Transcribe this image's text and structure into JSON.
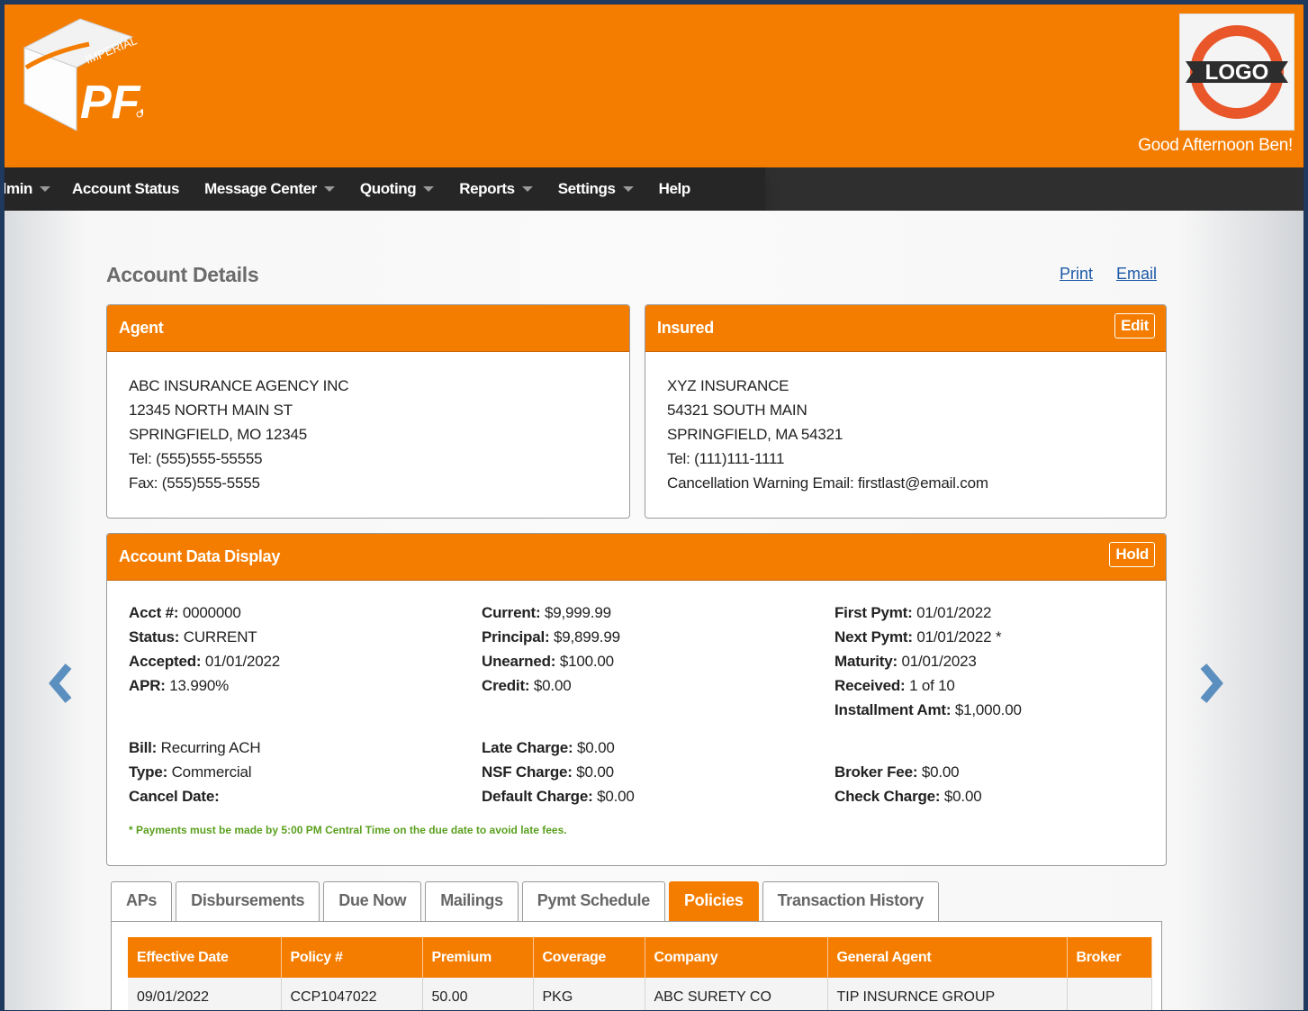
{
  "brand": {
    "logo_text_top": "IMPERIAL",
    "logo_text_main": "PFS",
    "client_logo_text": "LOGO",
    "greeting": "Good Afternoon Ben!",
    "colors": {
      "primary": "#f47d00",
      "nav": "#262626",
      "link": "#1d5aa8",
      "note": "#5aa01e"
    }
  },
  "nav": {
    "items": [
      {
        "label": "dmin",
        "dropdown": true
      },
      {
        "label": "Account Status",
        "dropdown": false
      },
      {
        "label": "Message Center",
        "dropdown": true
      },
      {
        "label": "Quoting",
        "dropdown": true
      },
      {
        "label": "Reports",
        "dropdown": true
      },
      {
        "label": "Settings",
        "dropdown": true
      },
      {
        "label": "Help",
        "dropdown": false
      }
    ]
  },
  "page": {
    "title": "Account Details",
    "print_label": "Print",
    "email_label": "Email"
  },
  "agent": {
    "title": "Agent",
    "lines": [
      "ABC INSURANCE AGENCY INC",
      "12345 NORTH MAIN ST",
      "SPRINGFIELD, MO 12345",
      "Tel: (555)555-55555",
      "Fax: (555)555-5555"
    ]
  },
  "insured": {
    "title": "Insured",
    "edit_label": "Edit",
    "lines": [
      "XYZ INSURANCE",
      "54321 SOUTH MAIN",
      "SPRINGFIELD, MA 54321",
      "Tel: (111)111-1111",
      "Cancellation Warning Email: firstlast@email.com"
    ]
  },
  "account": {
    "title": "Account Data Display",
    "hold_label": "Hold",
    "col1": [
      {
        "label": "Acct #:",
        "value": "0000000"
      },
      {
        "label": "Status:",
        "value": "CURRENT"
      },
      {
        "label": "Accepted:",
        "value": "01/01/2022"
      },
      {
        "label": "APR:",
        "value": "13.990%"
      }
    ],
    "col1b": [
      {
        "label": "Bill:",
        "value": "Recurring ACH"
      },
      {
        "label": "Type:",
        "value": "Commercial"
      },
      {
        "label": "Cancel Date:",
        "value": ""
      }
    ],
    "col2": [
      {
        "label": "Current:",
        "value": "$9,999.99"
      },
      {
        "label": "Principal:",
        "value": "$9,899.99"
      },
      {
        "label": "Unearned:",
        "value": "$100.00"
      },
      {
        "label": "Credit:",
        "value": "$0.00"
      }
    ],
    "col2b": [
      {
        "label": "Late Charge:",
        "value": "$0.00"
      },
      {
        "label": "NSF Charge:",
        "value": "$0.00"
      },
      {
        "label": "Default Charge:",
        "value": "$0.00"
      }
    ],
    "col3": [
      {
        "label": "First Pymt:",
        "value": "01/01/2022"
      },
      {
        "label": "Next Pymt:",
        "value": "01/01/2022 *"
      },
      {
        "label": "Maturity:",
        "value": "01/01/2023"
      },
      {
        "label": "Received:",
        "value": "1 of 10"
      },
      {
        "label": "Installment Amt:",
        "value": "$1,000.00"
      }
    ],
    "col3b": [
      {
        "label": "Broker Fee:",
        "value": "$0.00"
      },
      {
        "label": "Check Charge:",
        "value": "$0.00"
      }
    ],
    "note": "* Payments must be made by 5:00 PM Central Time on the due date to avoid late fees."
  },
  "tabs": [
    {
      "label": "APs",
      "active": false
    },
    {
      "label": "Disbursements",
      "active": false
    },
    {
      "label": "Due Now",
      "active": false
    },
    {
      "label": "Mailings",
      "active": false
    },
    {
      "label": "Pymt Schedule",
      "active": false
    },
    {
      "label": "Policies",
      "active": true
    },
    {
      "label": "Transaction History",
      "active": false
    }
  ],
  "policies": {
    "columns": [
      "Effective Date",
      "Policy #",
      "Premium",
      "Coverage",
      "Company",
      "General Agent",
      "Broker"
    ],
    "rows": [
      [
        "09/01/2022",
        "CCP1047022",
        "50.00",
        "PKG",
        "ABC SURETY CO",
        "TIP INSURNCE GROUP",
        ""
      ]
    ]
  }
}
